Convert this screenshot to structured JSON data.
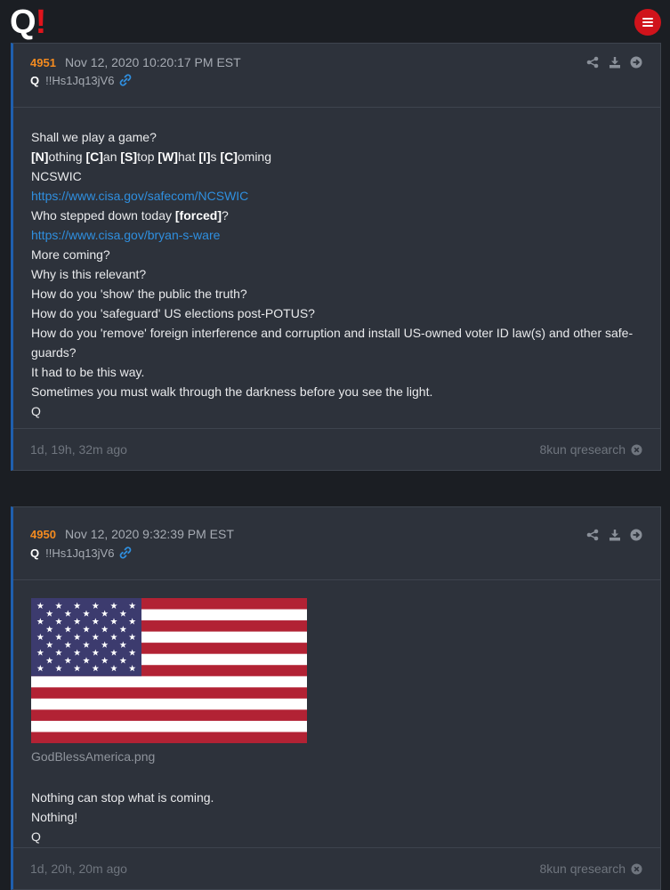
{
  "header": {
    "logo_q": "Q",
    "logo_bang": "!"
  },
  "posts": [
    {
      "number": "4951",
      "date": "Nov 12, 2020 10:20:17 PM EST",
      "author": "Q",
      "tripcode": "!!Hs1Jq13jV6",
      "lines": {
        "l1": "Shall we play a game?",
        "l2_a": "[N]",
        "l2_b": "othing ",
        "l2_c": "[C]",
        "l2_d": "an ",
        "l2_e": "[S]",
        "l2_f": "top ",
        "l2_g": "[W]",
        "l2_h": "hat ",
        "l2_i": "[I]",
        "l2_j": "s ",
        "l2_k": "[C]",
        "l2_l": "oming",
        "l3": "NCSWIC",
        "l4": "https://www.cisa.gov/safecom/NCSWIC",
        "l5_a": "Who stepped down today ",
        "l5_b": "[forced]",
        "l5_c": "?",
        "l6": "https://www.cisa.gov/bryan-s-ware",
        "l7": "More coming?",
        "l8": "Why is this relevant?",
        "l9": "How do you 'show' the public the truth?",
        "l10": "How do you 'safeguard' US elections post-POTUS?",
        "l11": "How do you 'remove' foreign interference and corruption and install US-owned voter ID law(s) and other safe-",
        "l12": "guards?",
        "l13": "It had to be this way.",
        "l14": "Sometimes you must walk through the darkness before you see the light.",
        "l15": "Q"
      },
      "ago": "1d, 19h, 32m ago",
      "source": "8kun qresearch"
    },
    {
      "number": "4950",
      "date": "Nov 12, 2020 9:32:39 PM EST",
      "author": "Q",
      "tripcode": "!!Hs1Jq13jV6",
      "image_filename": "GodBlessAmerica.png",
      "lines": {
        "l1": "Nothing can stop what is coming.",
        "l2": "Nothing!",
        "l3": "Q"
      },
      "ago": "1d, 20h, 20m ago",
      "source": "8kun qresearch"
    }
  ],
  "colors": {
    "background": "#1b1e23",
    "card": "#2d323b",
    "post_number": "#f58b1f",
    "link": "#2f8fdf",
    "menu_button": "#d0131b"
  },
  "icons": [
    "menu-icon",
    "share-icon",
    "download-icon",
    "arrow-circle-icon",
    "link-icon",
    "close-circle-icon",
    "us-flag-image"
  ]
}
